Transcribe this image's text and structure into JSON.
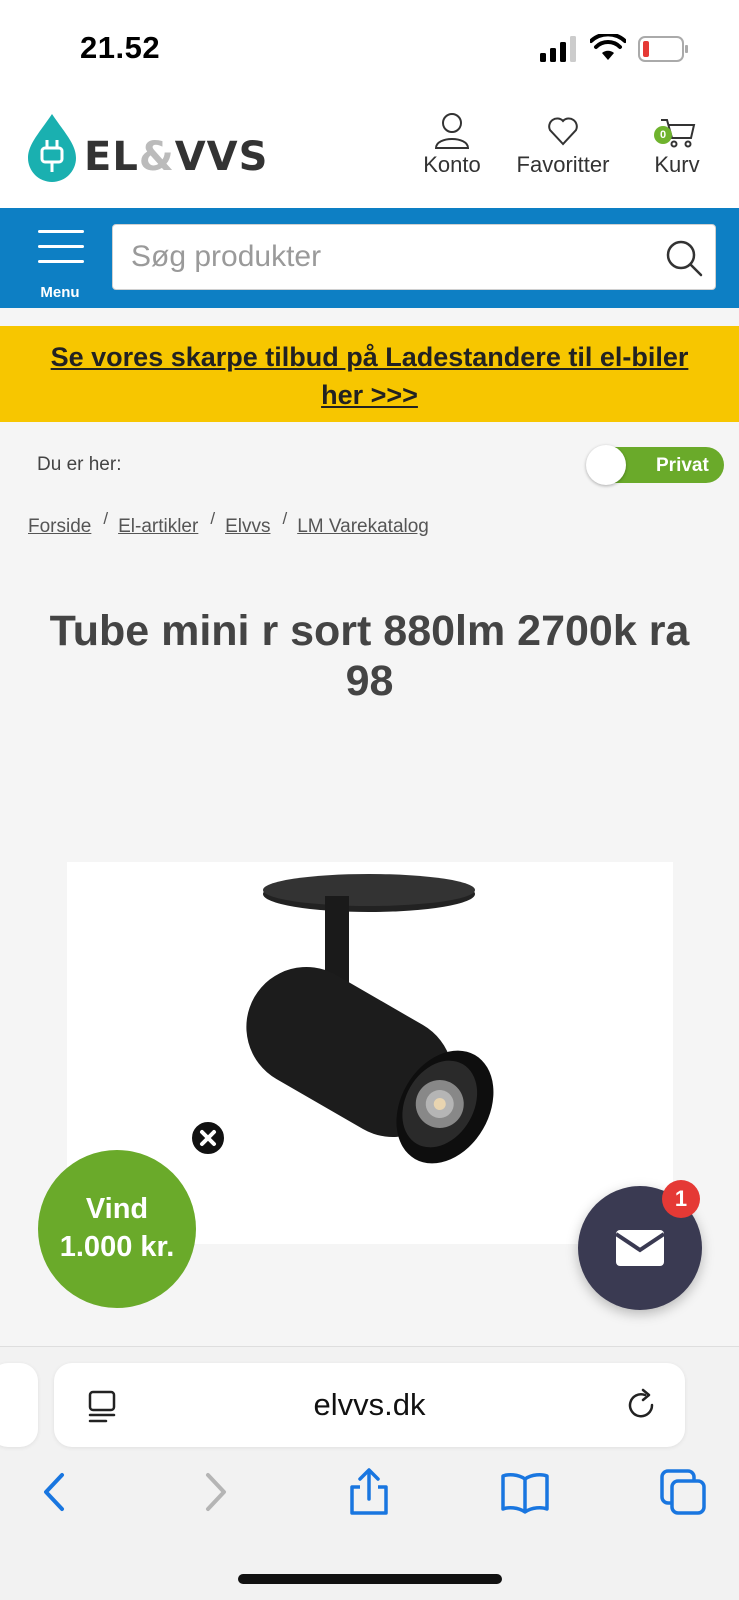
{
  "status": {
    "time": "21.52"
  },
  "header": {
    "logo_text_a": "EL",
    "logo_amp": "&",
    "logo_text_b": "VVS",
    "account_label": "Konto",
    "favorites_label": "Favoritter",
    "cart_label": "Kurv",
    "cart_count": "0",
    "brand_color": "#1ab0b0"
  },
  "search": {
    "menu_label": "Menu",
    "placeholder": "Søg produkter",
    "bar_color": "#0d7fc4"
  },
  "promo": {
    "text": "Se vores skarpe tilbud på Ladestandere til el-biler her >>>",
    "color": "#f7c600"
  },
  "location": {
    "label": "Du er her:",
    "toggle_label": "Privat",
    "breadcrumb": [
      "Forside",
      "El-artikler",
      "Elvvs",
      "LM Varekatalog"
    ],
    "breadcrumb_sep": "/"
  },
  "product": {
    "title": "Tube mini r sort 880lm 2700k ra 98"
  },
  "popup": {
    "line1": "Vind",
    "line2": "1.000 kr."
  },
  "chat": {
    "badge": "1"
  },
  "browser": {
    "url": "elvvs.dk"
  }
}
